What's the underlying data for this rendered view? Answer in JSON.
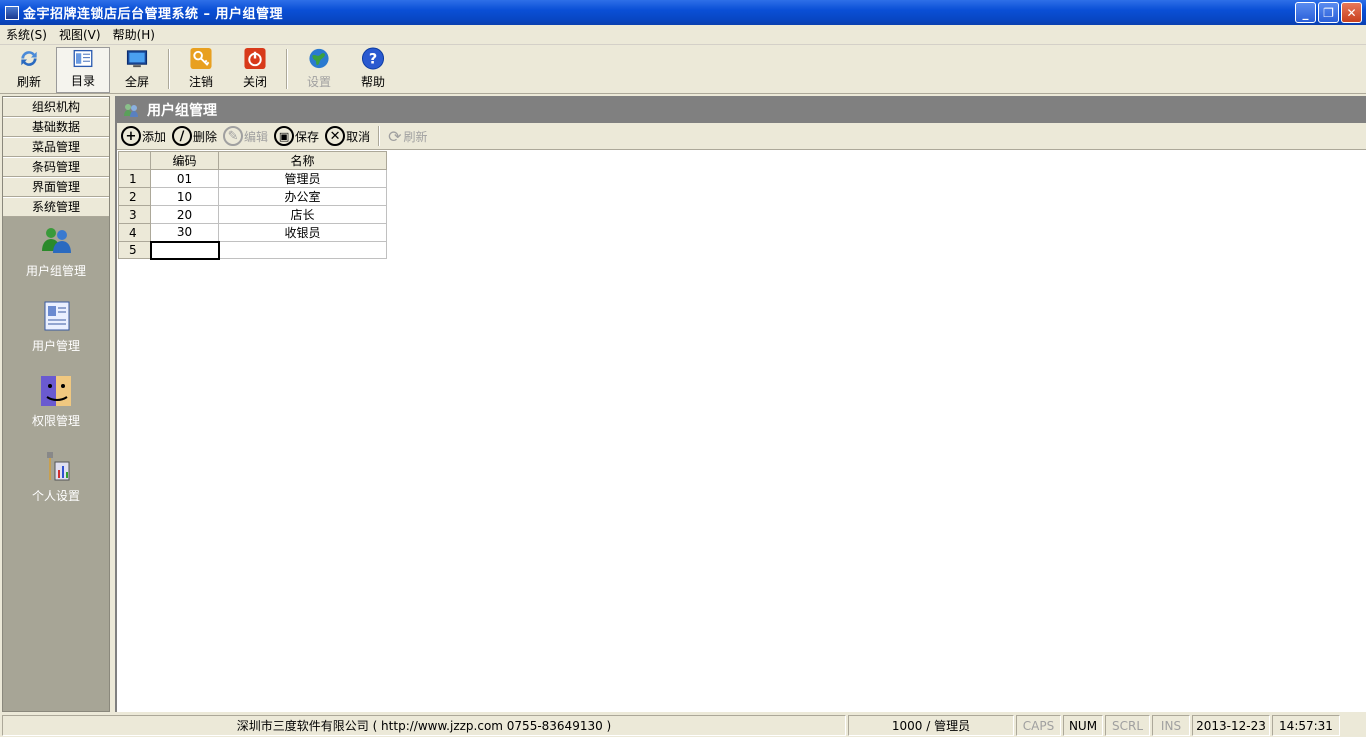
{
  "window": {
    "title": "金宇招牌连锁店后台管理系统  –  用户组管理",
    "minimize": "_",
    "restore": "❐",
    "close": "✕"
  },
  "menu": [
    {
      "label": "系统(S)"
    },
    {
      "label": "视图(V)"
    },
    {
      "label": "帮助(H)"
    }
  ],
  "toolbar": {
    "refresh": "刷新",
    "catalog": "目录",
    "fullscreen": "全屏",
    "logout": "注销",
    "close": "关闭",
    "settings": "设置",
    "help": "帮助"
  },
  "sidebar": {
    "tabs": [
      "组织机构",
      "基础数据",
      "菜品管理",
      "条码管理",
      "界面管理",
      "系统管理"
    ],
    "items": [
      "用户组管理",
      "用户管理",
      "权限管理",
      "个人设置"
    ]
  },
  "panel": {
    "title": "用户组管理",
    "actions": {
      "add": "添加",
      "delete": "删除",
      "edit": "编辑",
      "save": "保存",
      "cancel": "取消",
      "refresh": "刷新"
    }
  },
  "grid": {
    "columns": {
      "code": "编码",
      "name": "名称"
    },
    "rows": [
      {
        "num": "1",
        "code": "01",
        "name": "管理员"
      },
      {
        "num": "2",
        "code": "10",
        "name": "办公室"
      },
      {
        "num": "3",
        "code": "20",
        "name": "店长"
      },
      {
        "num": "4",
        "code": "30",
        "name": "收银员"
      },
      {
        "num": "5",
        "code": "",
        "name": ""
      }
    ]
  },
  "status": {
    "company": "深圳市三度软件有限公司 ( http://www.jzzp.com  0755-83649130 )",
    "user": "1000 / 管理员",
    "caps": "CAPS",
    "num": "NUM",
    "scrl": "SCRL",
    "ins": "INS",
    "date": "2013-12-23",
    "time": "14:57:31"
  }
}
